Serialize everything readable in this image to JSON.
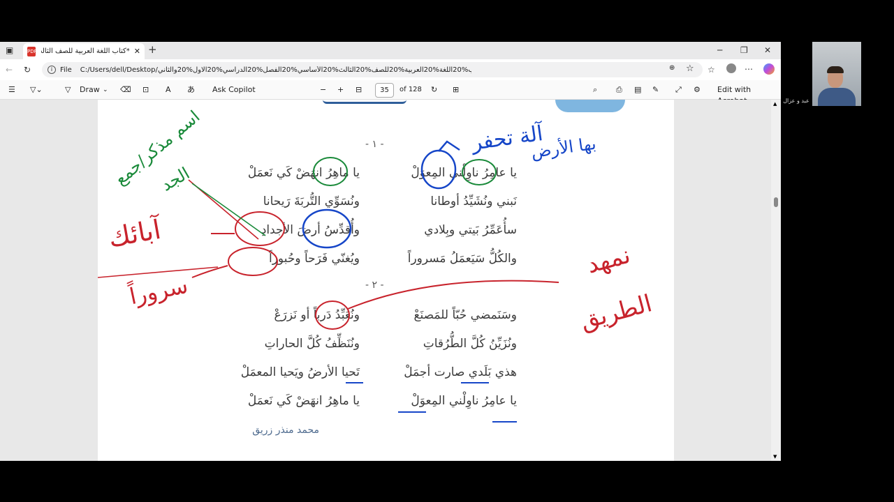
{
  "tab": {
    "title": "*كتاب اللغة العربية للصف الثالث الأ",
    "close": "✕",
    "new": "+"
  },
  "window": {
    "minimize": "─",
    "restore": "❐",
    "close": "✕"
  },
  "address": {
    "label": "File",
    "url": "C:/Users/dell/Desktop/كتاب%20اللغة%20العربية%20للصف%20الثالث%20الأساسي%20الفصل%20الدراسي%20الاول%20والثاني.pdf"
  },
  "toolbar": {
    "draw": "Draw",
    "ask_copilot": "Ask Copilot",
    "page_current": "35",
    "page_total": "of 128",
    "edit_acrobat": "Edit with Acrobat"
  },
  "poem": {
    "stanza1": "- ١ -",
    "stanza2": "- ٢ -",
    "lines": [
      {
        "right": "يا عامِرُ ناوِلْني المِعوَلْ",
        "left": "يا ماهِرُ انهَضْ كَي نَعمَلْ"
      },
      {
        "right": "نَبني ونُشَيِّدُ أوطانا",
        "left": "ونُسَوِّي التُّربَةَ رَيحانا"
      },
      {
        "right": "سأُعَمِّرُ بَيتي وبِلادي",
        "left": "وأُقدِّسُ أرضَ الأجدادِ"
      },
      {
        "right": "والكُلُّ سَيَعمَلُ مَسروراً",
        "left": "ويُغنّي فَرَحاً وحُبوراً"
      },
      {
        "right": "وسَنَمضي حُبّاً للمَصنَعْ",
        "left": "ونُعَبِّدُ دَرباً أو نَزرَعْ"
      },
      {
        "right": "ونُزَيِّنُ كُلَّ الطُّرُقاتِ",
        "left": "ونُنَظِّفُ كُلَّ الحاراتِ"
      },
      {
        "right": "هذي بَلَدي صارت أجمَلْ",
        "left": "تَحيا الأرضُ ويَحيا المعمَلْ"
      },
      {
        "right": "يا عامِرُ ناوِلْني المِعوَلْ",
        "left": "يا ماهِرُ انهَضْ كَي نَعمَلْ"
      }
    ],
    "author": "محمد منذر زريق"
  },
  "handwriting": {
    "note1": "آلة تحفر",
    "note2": "بها الأرض",
    "note3": "اسم مذكر/جمع",
    "note4": "الجد",
    "note5": "آبائك",
    "note6": "سروراً",
    "note7": "نمهد",
    "note8": "الطريق"
  },
  "webcam": {
    "name": "عبد و عزال"
  },
  "colors": {
    "ink_blue": "#1646c8",
    "ink_green": "#1a8a3a",
    "ink_red": "#c8232c"
  }
}
